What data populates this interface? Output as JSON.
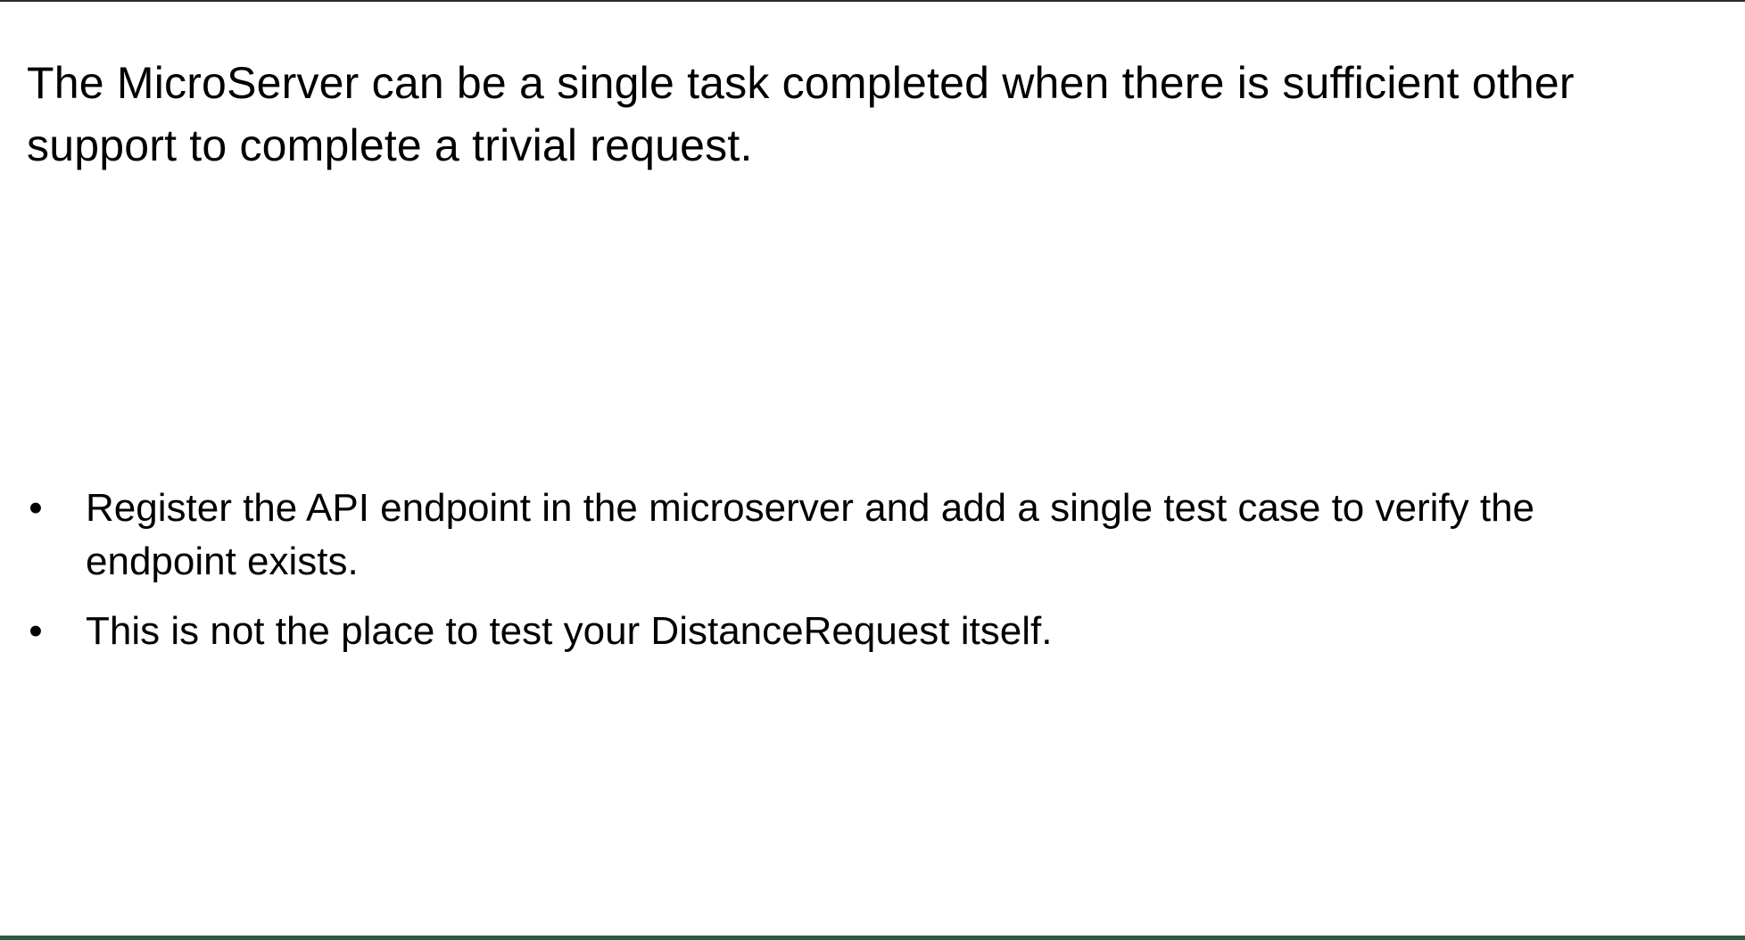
{
  "slide": {
    "title": "The MicroServer can be a single task completed when there is sufficient other support to complete a trivial request.",
    "bullets": [
      {
        "marker": "•",
        "text": "Register the API endpoint in the microserver and add a single test case to verify the endpoint exists."
      },
      {
        "marker": "•",
        "text": "This is not the place to test your DistanceRequest itself."
      }
    ]
  }
}
